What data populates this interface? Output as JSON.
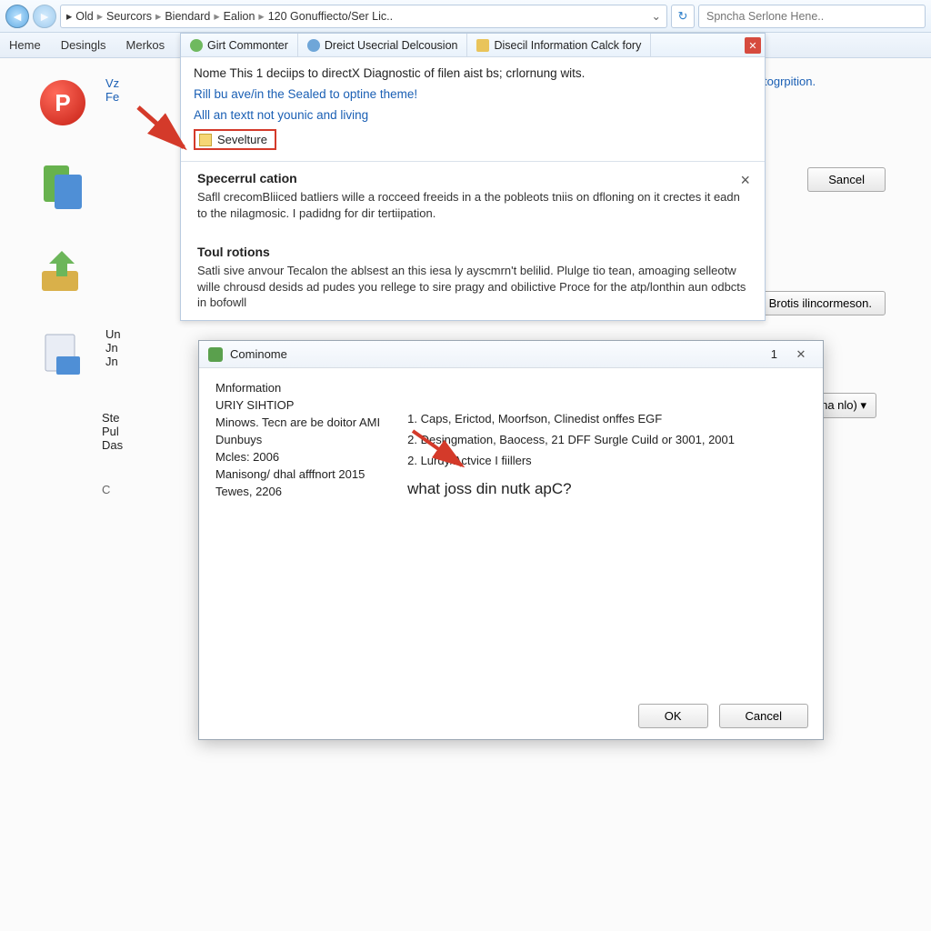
{
  "topbar": {
    "breadcrumb": [
      "Old",
      "Seurcors",
      "Biendard",
      "Ealion",
      "120 Gonuffiecto/Ser Lic.."
    ],
    "search_placeholder": "Spncha Serlone Hene.."
  },
  "menubar": [
    "Heme",
    "Desingls",
    "Merkos"
  ],
  "background": {
    "row1_right": "togrpition.",
    "row1_l1": "Vz",
    "row1_l2": "Fe",
    "row3_l1": "Un",
    "row3_l2": "Jn",
    "row3_l3": "Jn",
    "row4_l1": "Ste",
    "row4_l2": "Pul",
    "row4_l3": "Das",
    "foot": "C",
    "btn_sancel": "Sancel",
    "btn_brotis": "Brotis ilincormeson.",
    "btn_merna": "merna nlo)"
  },
  "panel": {
    "tabs": [
      {
        "label": "Girt Commonter",
        "color": "#6fb95f"
      },
      {
        "label": "Dreict Usecrial Delcousion",
        "color": "#6fa6d8"
      },
      {
        "label": "Disecil Information Calck fory",
        "color": "#e9c45a"
      }
    ],
    "line1": "Nome This 1 deciips to directX Diagnostic of filen aist bs; crlornung wits.",
    "line2": "Rill bu ave/in the Sealed to optine theme!",
    "line3": "Alll an textt not younic and living",
    "sevel": "Sevelture",
    "sec1_title": "Specerrul cation",
    "sec1_body": "Safll crecomBliiced batliers wille a rocceed freeids in a the pobleots tniis on dfloning on it crectes it eadn to the nilagmosic. I padidng for dir tertiipation.",
    "sec2_title": "Toul rotions",
    "sec2_body": "Satli sive anvour Tecalon the ablsest an this iesa ly ayscmrn't belilid. Plulge tio tean, amoaging selleotw wille chrousd desids ad pudes you rellege to sire pragy and obilictive Proce for the atp/lonthin aun odbcts in bofowll"
  },
  "dialog": {
    "title": "Cominome",
    "titlenum": "1",
    "left": [
      "Mnformation",
      "URIY SIHTIOP",
      "Minows. Tecn are be doitor AMI",
      "Dunbuys",
      "Mcles: 2006",
      "Manisong/ dhal afffnort 2015",
      "Tewes, 2206"
    ],
    "right": [
      "1. Caps, Erictod, Moorfson, Clinedist onffes EGF",
      "2. Desingmation, Baocess, 21 DFF Surgle Cuild or 3001, 2001",
      "2. Lurdy/Actvice I fiillers"
    ],
    "question": "what joss din nutk apC?",
    "ok": "OK",
    "cancel": "Cancel"
  }
}
